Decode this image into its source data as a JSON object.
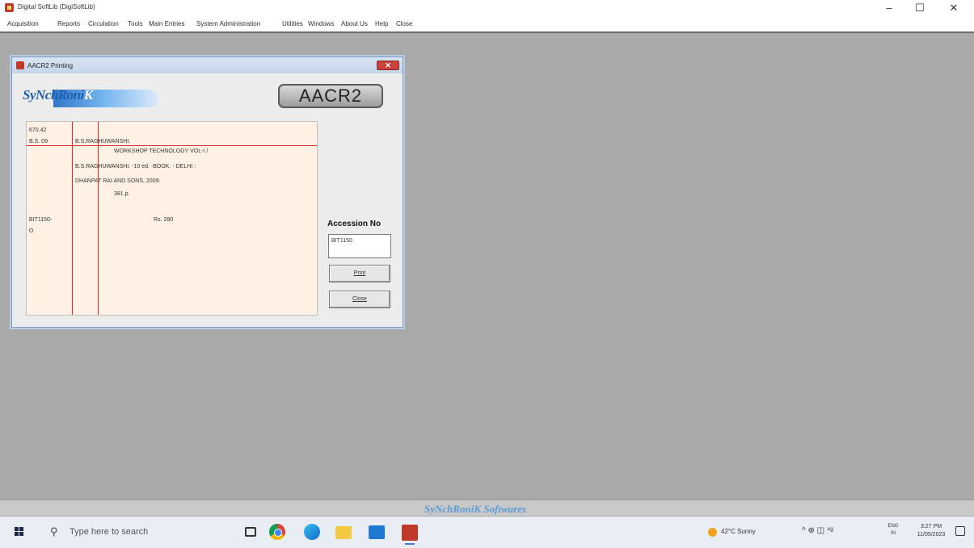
{
  "window": {
    "title": "Digital SoftLib (DigiSoftLib)",
    "controls": {
      "minimize": "–",
      "maximize": "☐",
      "close": "✕"
    }
  },
  "menu": [
    "Acquisition",
    "Reports",
    "Circulation",
    "Tools",
    "Main Entries",
    "System Administration",
    "Utilities",
    "Windows",
    "About Us",
    "Help",
    "Close"
  ],
  "dialog": {
    "title": "AACR2 Printing",
    "logo": {
      "main": "SyNchRoni",
      "accent": "K"
    },
    "badge": "AACR2",
    "card": {
      "call_no": "670.42",
      "author_mark": "B.S.  09",
      "main_entry": "B.S.RAGHUWANSHI.",
      "title_line": "WORKSHOP TECHNOLOGY VOL-I /",
      "statement_line": "B.S.RAGHUWANSHI. -10 ed. -BOOK. - DELHI :",
      "publisher_line": "DHANPAT RAI AND SONS, 2009.",
      "pages": "381 p.",
      "accession": "BIT1150-",
      "accession_suffix": "O",
      "price": "Rs. 280"
    },
    "accession_label": "Accession No",
    "accession_value": "BIT1150",
    "print_button": "Print",
    "close_button": "Close"
  },
  "statusbar": {
    "brand": "SyNchRoniK Softwares"
  },
  "taskbar": {
    "search_placeholder": "Type here to search",
    "weather": "42°C  Sunny",
    "tray_icons": "^  ⊕  ◫  ⁴ᵍ",
    "lang_top": "ENG",
    "lang_bottom": "IN",
    "time": "3:27 PM",
    "date": "11/05/2023"
  },
  "colors": {
    "desktop": "#a9a9a9",
    "card_bg": "#fff2e4",
    "card_lines": "#d0302b",
    "brand_blue": "#5b9bd5"
  }
}
